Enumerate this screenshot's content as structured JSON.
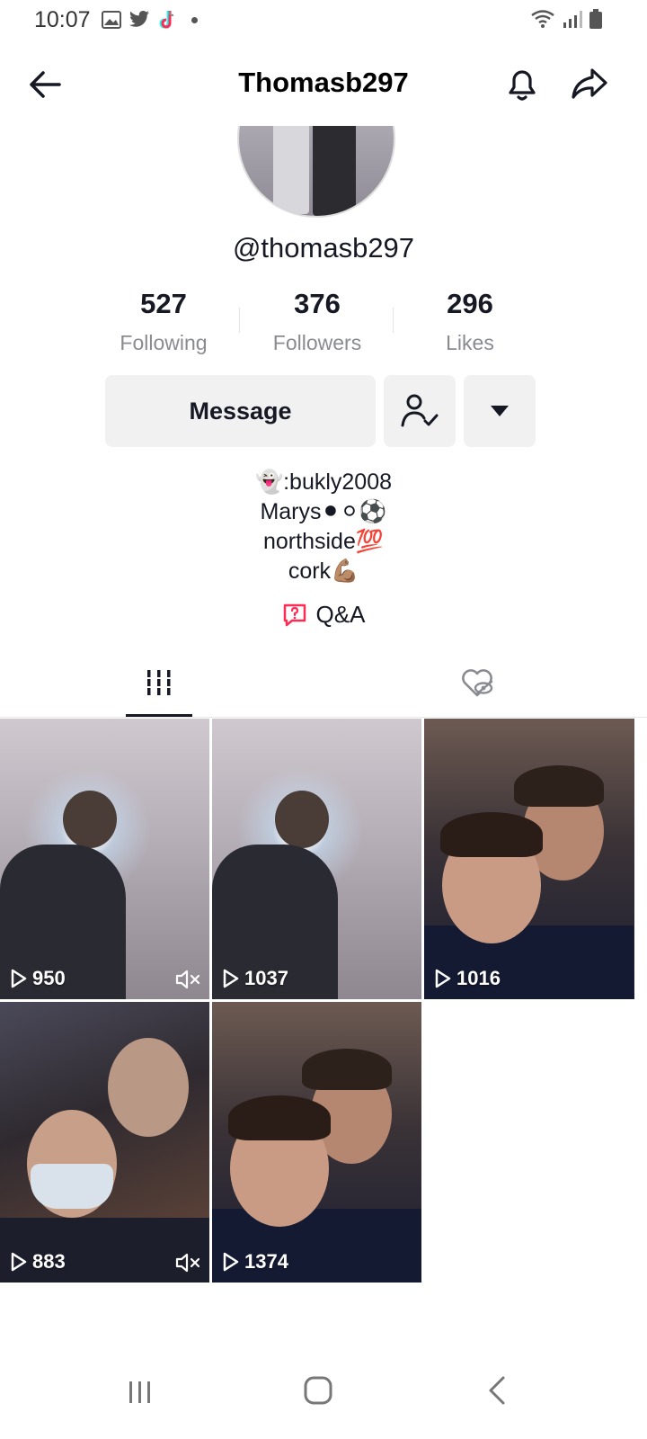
{
  "status_bar": {
    "time": "10:07"
  },
  "header": {
    "title": "Thomasb297"
  },
  "profile": {
    "username": "@thomasb297",
    "stats": [
      {
        "value": "527",
        "label": "Following"
      },
      {
        "value": "376",
        "label": "Followers"
      },
      {
        "value": "296",
        "label": "Likes"
      }
    ],
    "message_label": "Message",
    "bio_lines": [
      "👻:bukly2008",
      "Marys⚫⚪⚽",
      "northside💯",
      "cork💪🏽"
    ],
    "qa_label": "Q&A"
  },
  "videos": [
    {
      "views": "950",
      "muted": true
    },
    {
      "views": "1037",
      "muted": false
    },
    {
      "views": "1016",
      "muted": false
    },
    {
      "views": "883",
      "muted": true
    },
    {
      "views": "1374",
      "muted": false
    }
  ],
  "icons": {
    "back": "arrow-left-icon",
    "bell": "bell-icon",
    "share": "share-arrow-icon",
    "follow_state": "user-check-icon",
    "more": "caret-down-icon",
    "qa": "question-bubble-icon",
    "videos_tab": "grid-bars-icon",
    "liked_tab": "heart-hidden-icon",
    "play": "play-icon",
    "mute": "mute-icon"
  },
  "colors": {
    "accent": "#fe2c55",
    "text": "#161823",
    "muted_text": "#8a8b91",
    "button_bg": "#f1f1f2"
  }
}
